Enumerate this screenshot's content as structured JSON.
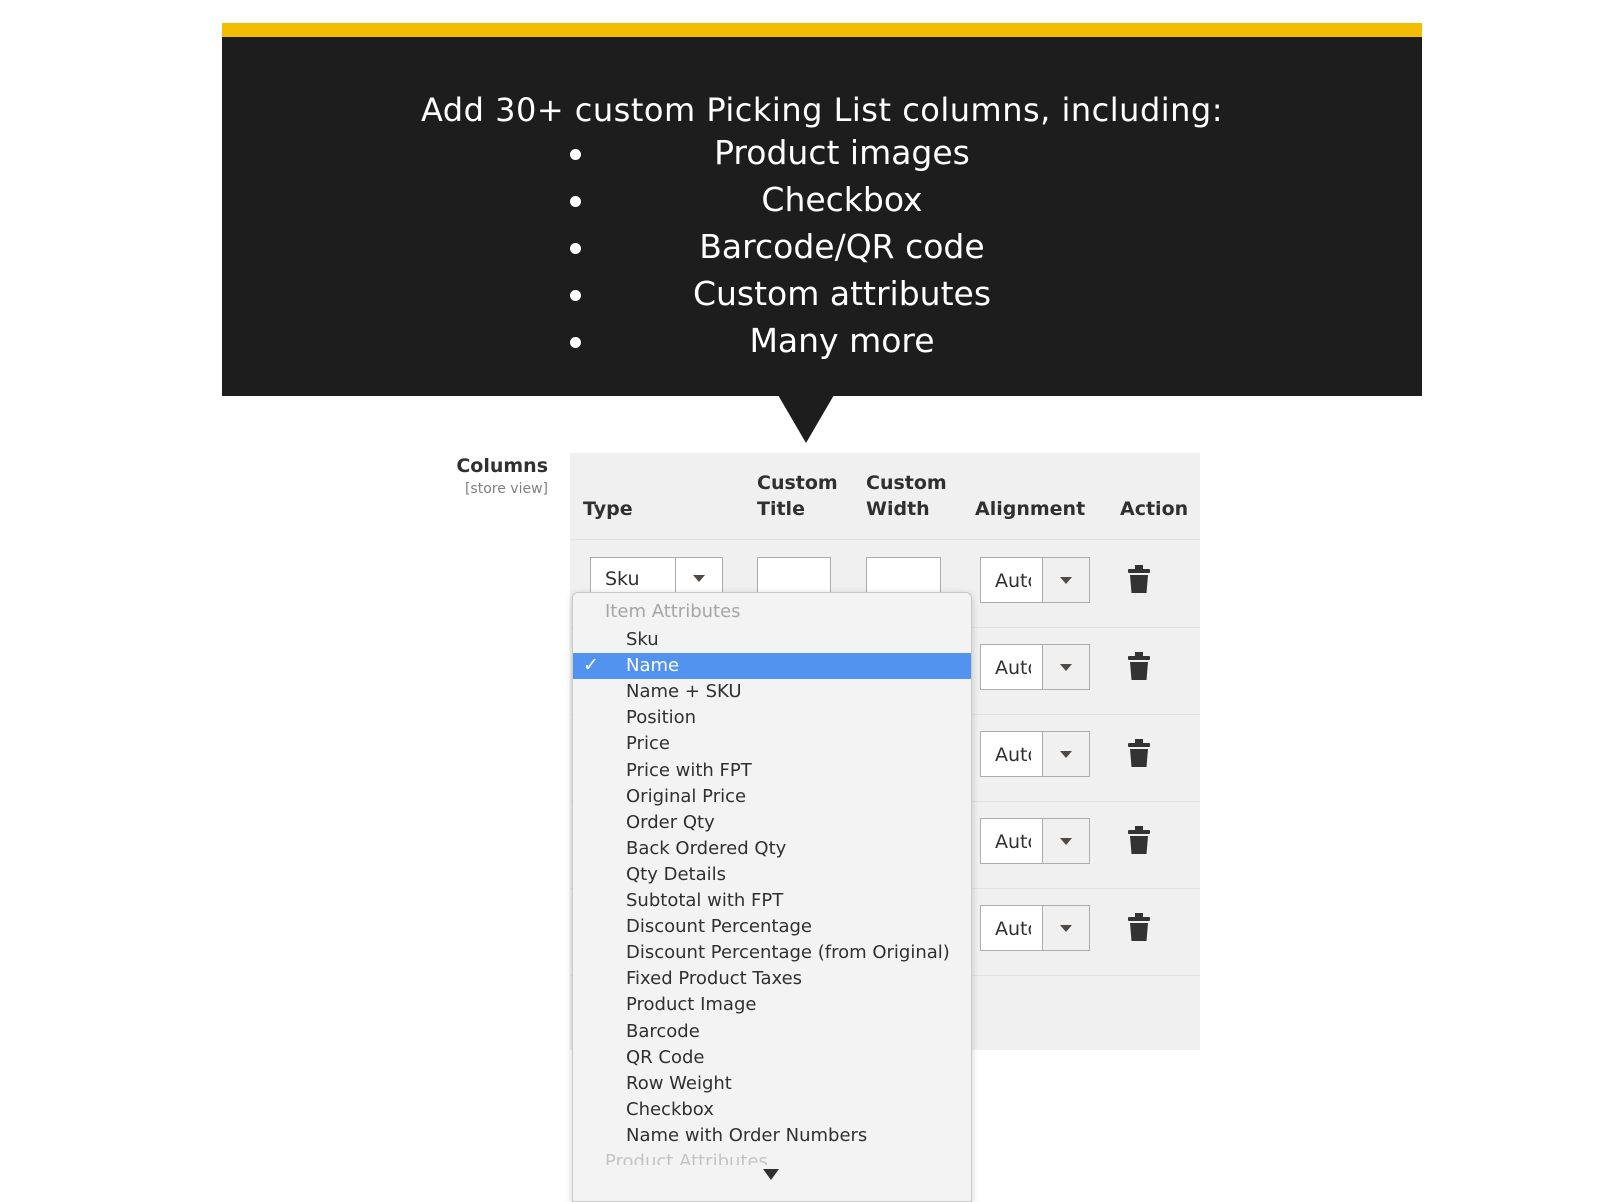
{
  "banner": {
    "title": "Add 30+ custom Picking List columns, including:",
    "bullets": [
      "Product images",
      "Checkbox",
      "Barcode/QR code",
      "Custom attributes",
      "Many more"
    ],
    "accent_color": "#f5bd00",
    "background_color": "#1d1d1d"
  },
  "field": {
    "label": "Columns",
    "scope": "[store view]"
  },
  "grid": {
    "headers": {
      "type": "Type",
      "custom_title_1": "Custom",
      "custom_title_2": "Title",
      "custom_width_1": "Custom",
      "custom_width_2": "Width",
      "alignment": "Alignment",
      "action": "Action"
    },
    "rows": [
      {
        "type": "Sku",
        "alignment": "Auto"
      },
      {
        "type": "",
        "alignment": "Auto"
      },
      {
        "type": "",
        "alignment": "Auto"
      },
      {
        "type": "",
        "alignment": "Auto"
      },
      {
        "type": "",
        "alignment": "Auto"
      }
    ]
  },
  "dropdown": {
    "group_label": "Item Attributes",
    "selected": "Name",
    "check_mark": "✓",
    "options": [
      "Sku",
      "Name",
      "Name + SKU",
      "Position",
      "Price",
      "Price with FPT",
      "Original Price",
      "Order Qty",
      "Back Ordered Qty",
      "Qty Details",
      "Subtotal with FPT",
      "Discount Percentage",
      "Discount Percentage (from Original)",
      "Fixed Product Taxes",
      "Product Image",
      "Barcode",
      "QR Code",
      "Row Weight",
      "Checkbox",
      "Name with Order Numbers"
    ],
    "next_group_label": "Product Attributes",
    "selected_color": "#5193ee"
  }
}
